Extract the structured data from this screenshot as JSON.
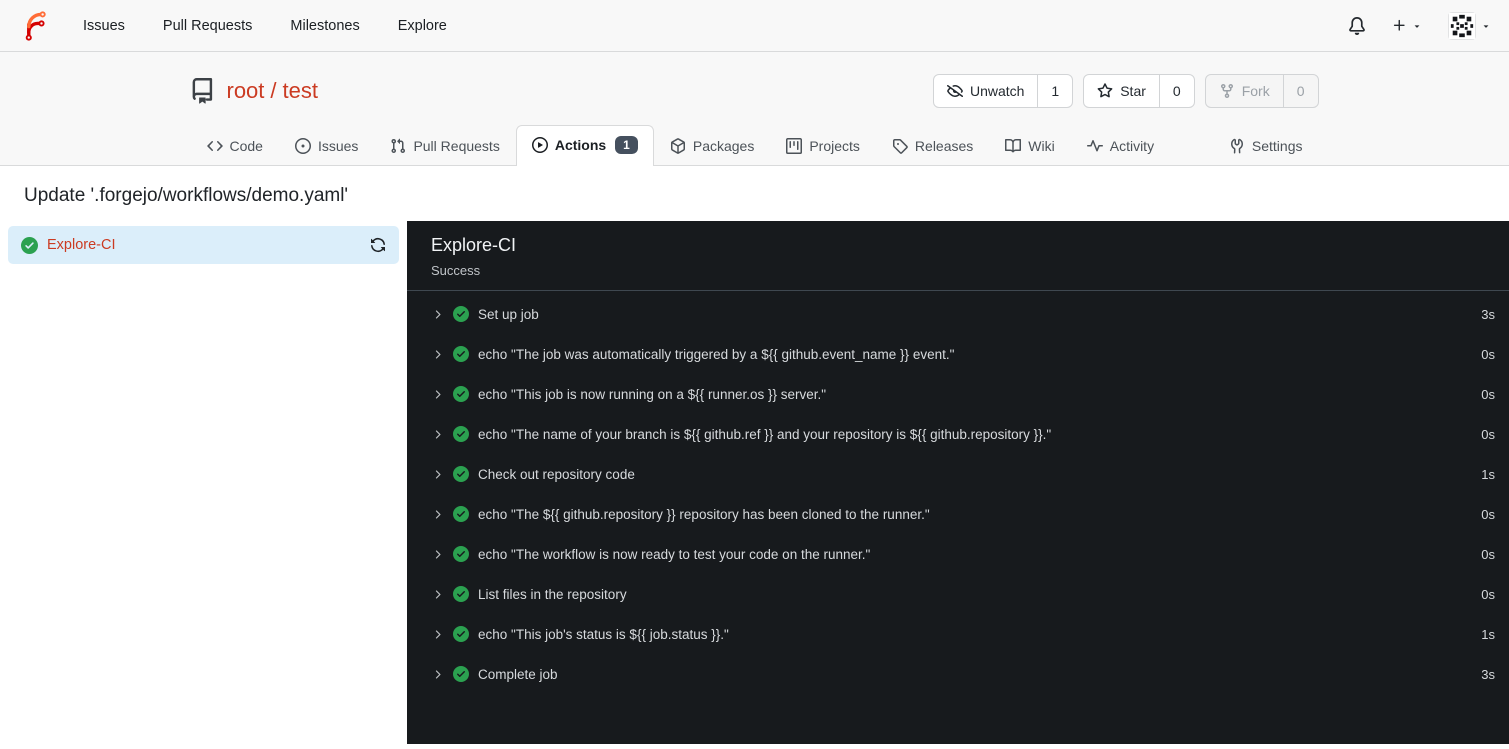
{
  "colors": {
    "accent_link": "#cb3b22",
    "success_green": "#2ba150",
    "panel_dark": "#171a1d",
    "job_selected_bg": "#dbeefa",
    "badge_bg": "#45505e"
  },
  "navbar": {
    "links": [
      "Issues",
      "Pull Requests",
      "Milestones",
      "Explore"
    ]
  },
  "repo": {
    "owner": "root",
    "separator": "/",
    "name": "test",
    "actions": [
      {
        "label": "Unwatch",
        "count": "1"
      },
      {
        "label": "Star",
        "count": "0"
      },
      {
        "label": "Fork",
        "count": "0"
      }
    ],
    "tabs": [
      "Code",
      "Issues",
      "Pull Requests",
      "Actions",
      "Packages",
      "Projects",
      "Releases",
      "Wiki",
      "Activity"
    ],
    "actions_badge": "1",
    "settings_tab": "Settings"
  },
  "page": {
    "title": "Update '.forgejo/workflows/demo.yaml'"
  },
  "sidebar": {
    "job_name": "Explore-CI"
  },
  "panel": {
    "title": "Explore-CI",
    "status": "Success",
    "steps": [
      {
        "label": "Set up job",
        "duration": "3s"
      },
      {
        "label": "echo \"The job was automatically triggered by a ${{ github.event_name }} event.\"",
        "duration": "0s"
      },
      {
        "label": "echo \"This job is now running on a ${{ runner.os }} server.\"",
        "duration": "0s"
      },
      {
        "label": "echo \"The name of your branch is ${{ github.ref }} and your repository is ${{ github.repository }}.\"",
        "duration": "0s"
      },
      {
        "label": "Check out repository code",
        "duration": "1s"
      },
      {
        "label": "echo \"The ${{ github.repository }} repository has been cloned to the runner.\"",
        "duration": "0s"
      },
      {
        "label": "echo \"The workflow is now ready to test your code on the runner.\"",
        "duration": "0s"
      },
      {
        "label": "List files in the repository",
        "duration": "0s"
      },
      {
        "label": "echo \"This job's status is ${{ job.status }}.\"",
        "duration": "1s"
      },
      {
        "label": "Complete job",
        "duration": "3s"
      }
    ]
  }
}
